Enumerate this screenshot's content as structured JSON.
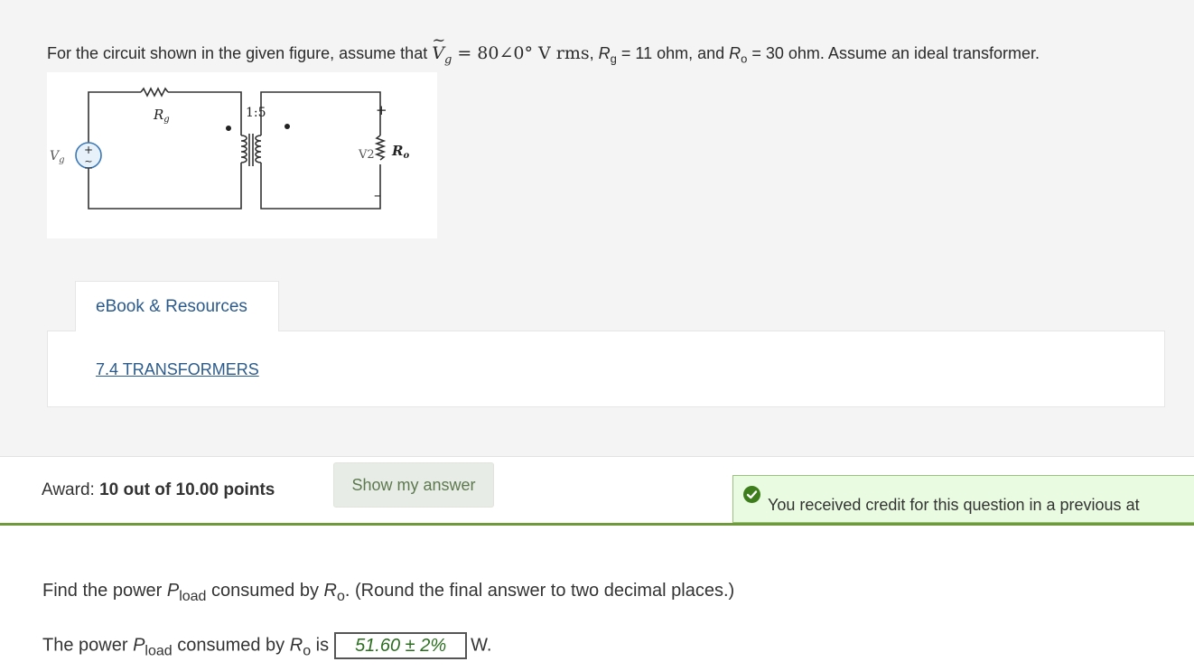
{
  "problem": {
    "intro": "For the circuit shown in the given figure, assume that ",
    "vg_symbol": "V",
    "vg_sub": "g",
    "vg_value": " = 80∠0° V rms",
    "rg_sep": ", ",
    "rg_symbol": "R",
    "rg_sub": "g",
    "rg_value": " = 11 ohm, and ",
    "ro_symbol": "R",
    "ro_sub": "o",
    "ro_value": " = 30 ohm. Assume an ideal transformer."
  },
  "figure": {
    "rg_label": "R",
    "rg_sub": "g",
    "ratio": "1:5",
    "vg_label": "V",
    "vg_sub": "g",
    "plus": "+",
    "minus": "–",
    "v2_label": "V2",
    "ro_label": "R",
    "ro_sub": "o"
  },
  "resources": {
    "tab_label": "eBook & Resources",
    "link_label": "7.4 TRANSFORMERS"
  },
  "award": {
    "prefix": "Award: ",
    "value": "10 out of 10.00 points"
  },
  "show_answer_label": "Show my answer",
  "credit_message": "You received credit for this question in a previous at",
  "question": {
    "prefix": "Find the power ",
    "p_symbol": "P",
    "p_sub": "load",
    "middle": " consumed by ",
    "r_symbol": "R",
    "r_sub": "o",
    "suffix": ". (Round the final answer to two decimal places.)"
  },
  "answer": {
    "prefix": "The power ",
    "p_symbol": "P",
    "p_sub": "load",
    "middle": " consumed by ",
    "r_symbol": "R",
    "r_sub": "o",
    "is_text": " is",
    "value": "51.60 ± 2%",
    "unit": "W."
  },
  "colors": {
    "link": "#2b5b8c",
    "success_green": "#3e7d1c",
    "divider_green": "#6e9a3c",
    "answer_green": "#2a6f1e"
  }
}
